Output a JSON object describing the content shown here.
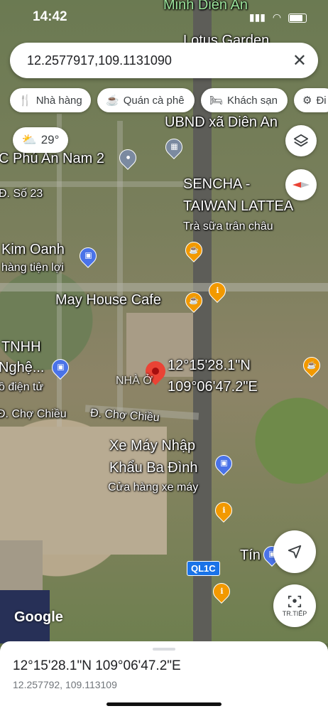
{
  "status_bar": {
    "time": "14:42"
  },
  "search": {
    "query": "12.2577917,109.1131090"
  },
  "chips": [
    {
      "label": "Nhà hàng",
      "icon": "restaurant-icon"
    },
    {
      "label": "Quán cà phê",
      "icon": "coffee-icon"
    },
    {
      "label": "Khách sạn",
      "icon": "hotel-icon"
    },
    {
      "label": "Đi",
      "icon": "attraction-icon"
    }
  ],
  "weather": {
    "temp": "29°",
    "icon": "partly-cloudy-icon"
  },
  "map_labels": {
    "top_partial": "Minh Diên An",
    "lotus": "Lotus Garden",
    "ubnd": "UBND xã Diên An",
    "phu_an": "C Phú An Nam 2",
    "sencha_line1": "SENCHA -",
    "sencha_line2": "TAIWAN LATTEA",
    "sencha_sub": "Trà sữa trân châu",
    "so23": "Đ. Số 23",
    "kim_oanh": "Kim Oanh",
    "kim_oanh_sub": "hàng tiện lợi",
    "may_house": "May House Cafe",
    "tnhh_line1": "TNHH",
    "tnhh_line2": "Nghệ...",
    "tnhh_sub": "ồ điện tử",
    "nha_o": "NHÀ Ở",
    "pin_lat": "12°15'28.1\"N",
    "pin_lng": "109°06'47.2\"E",
    "cho_chieu_left": "Đ. Chợ Chiều",
    "cho_chieu_right": "Đ. Chợ Chiều",
    "xe_may_line1": "Xe Máy Nhập",
    "xe_may_line2": "Khẩu Ba Đình",
    "xe_may_sub": "Cửa hàng xe máy",
    "tin": "Tín",
    "route": "QL1C",
    "google": "Google"
  },
  "controls": {
    "directions_label": "TR.TIẾP"
  },
  "bottom_sheet": {
    "dms": "12°15'28.1\"N 109°06'47.2\"E",
    "decimal": "12.257792, 109.113109"
  },
  "colors": {
    "pin": "#ea4335",
    "poi_food": "#f29900",
    "poi_shop": "#4a73e8",
    "route_badge": "#1a73e8"
  }
}
